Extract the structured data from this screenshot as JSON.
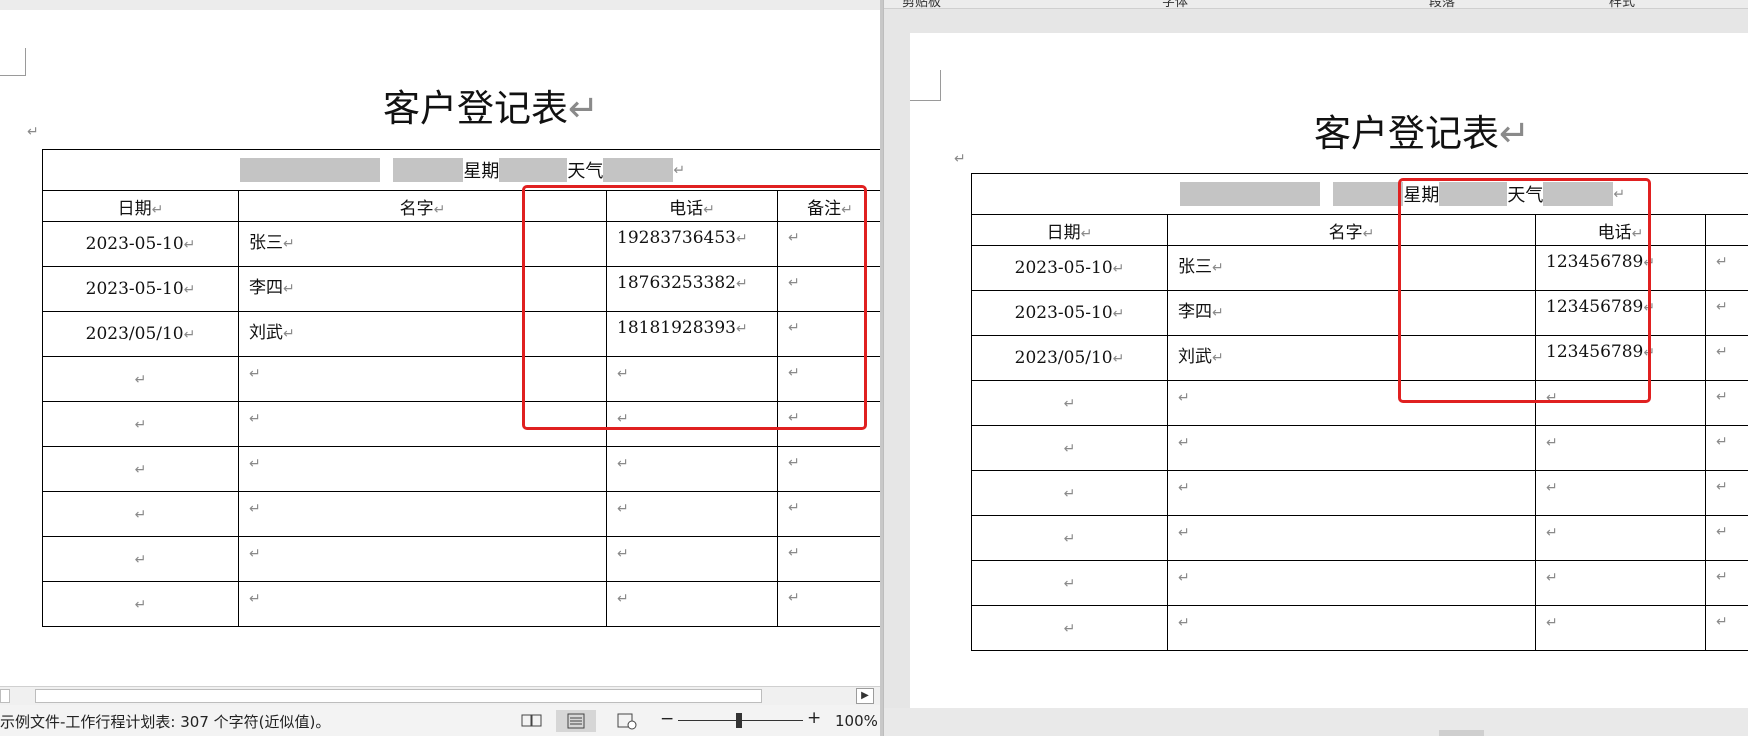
{
  "left_window": {
    "title": "客户登记表",
    "info_row": {
      "weekday_label": "星期",
      "weather_label": "天气"
    },
    "headers": [
      "日期",
      "名字",
      "",
      "电话",
      "备注"
    ],
    "rows": [
      {
        "date": "2023-05-10",
        "name": "张三",
        "phone": "19283736453"
      },
      {
        "date": "2023-05-10",
        "name": "李四",
        "phone": "18763253382"
      },
      {
        "date": "2023/05/10",
        "name": "刘武",
        "phone": "18181928393"
      },
      {
        "date": "",
        "name": "",
        "phone": ""
      },
      {
        "date": "",
        "name": "",
        "phone": ""
      },
      {
        "date": "",
        "name": "",
        "phone": ""
      },
      {
        "date": "",
        "name": "",
        "phone": ""
      },
      {
        "date": "",
        "name": "",
        "phone": ""
      },
      {
        "date": "",
        "name": "",
        "phone": ""
      }
    ],
    "status_bar": {
      "text": "示例文件-工作行程计划表: 307 个字符(近似值)。",
      "zoom_minus": "−",
      "zoom_plus": "+",
      "zoom": "100%"
    }
  },
  "right_window": {
    "ribbon_labels": [
      "剪贴板",
      "字体",
      "段落",
      "样式"
    ],
    "title": "客户登记表",
    "info_row": {
      "weekday_label": "星期",
      "weather_label": "天气"
    },
    "headers": [
      "日期",
      "名字",
      "电话",
      ""
    ],
    "rows": [
      {
        "date": "2023-05-10",
        "name": "张三",
        "phone": "123456789"
      },
      {
        "date": "2023-05-10",
        "name": "李四",
        "phone": "123456789"
      },
      {
        "date": "2023/05/10",
        "name": "刘武",
        "phone": "123456789"
      },
      {
        "date": "",
        "name": "",
        "phone": ""
      },
      {
        "date": "",
        "name": "",
        "phone": ""
      },
      {
        "date": "",
        "name": "",
        "phone": ""
      },
      {
        "date": "",
        "name": "",
        "phone": ""
      },
      {
        "date": "",
        "name": "",
        "phone": ""
      },
      {
        "date": "",
        "name": "",
        "phone": ""
      }
    ]
  },
  "paragraph_mark": "↵",
  "colors": {
    "highlight": "#e02020",
    "redaction": "#c4c4c4"
  }
}
